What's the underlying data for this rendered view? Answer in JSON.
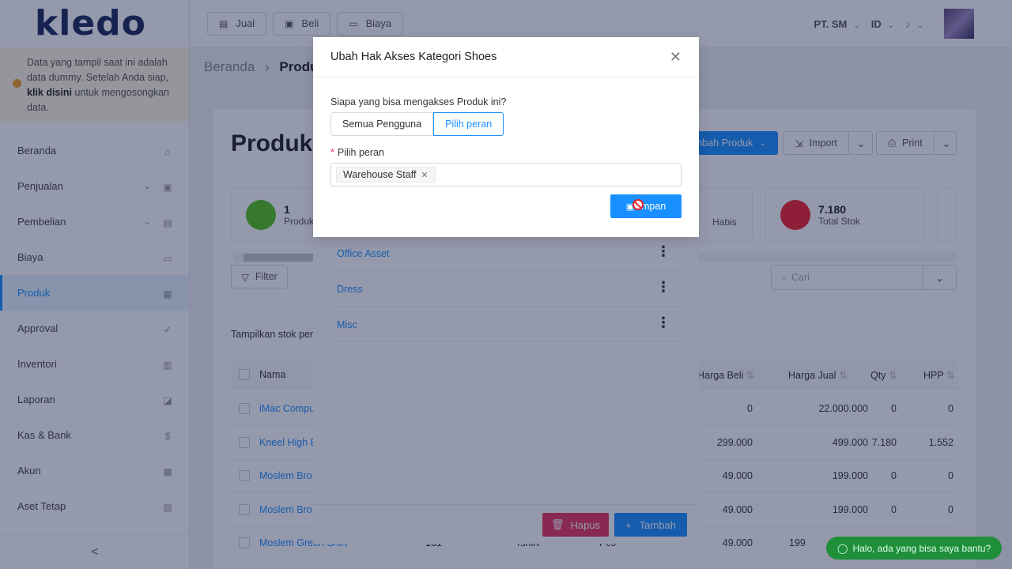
{
  "logo": "kledo",
  "notice": {
    "text_before": "Data yang tampil saat ini adalah data dummy. Setelah Anda siap, ",
    "link": "klik disini",
    "text_after": " untuk mengosongkan data."
  },
  "sidebar": {
    "items": [
      {
        "label": "Beranda",
        "icon": "home-icon"
      },
      {
        "label": "Penjualan",
        "icon": "basket-icon",
        "expand": true
      },
      {
        "label": "Pembelian",
        "icon": "bag-icon",
        "expand": true
      },
      {
        "label": "Biaya",
        "icon": "card-icon"
      },
      {
        "label": "Produk",
        "icon": "box-icon",
        "active": true
      },
      {
        "label": "Approval",
        "icon": "check-icon"
      },
      {
        "label": "Inventori",
        "icon": "warehouse-icon"
      },
      {
        "label": "Laporan",
        "icon": "chart-icon"
      },
      {
        "label": "Kas & Bank",
        "icon": "dollar-icon"
      },
      {
        "label": "Akun",
        "icon": "ledger-icon"
      },
      {
        "label": "Aset Tetap",
        "icon": "building-icon"
      }
    ],
    "collapse": "<"
  },
  "header": {
    "buttons": {
      "jual": "Jual",
      "beli": "Beli",
      "biaya": "Biaya"
    },
    "company": "PT. SM",
    "language": "ID"
  },
  "breadcrumb": {
    "home": "Beranda",
    "sep": "›",
    "current": "Produk"
  },
  "page": {
    "title": "Produk",
    "add_button": "nbah Produk",
    "import_button": "Import",
    "print_button": "Print"
  },
  "stats": [
    {
      "num": "1",
      "label": "Produk",
      "color": "#52c41a"
    },
    {
      "num": "",
      "label": "Habis",
      "color": ""
    },
    {
      "num": "7.180",
      "label": "Total Stok",
      "color": "#f5222d"
    }
  ],
  "toolbar": {
    "filter": "Filter",
    "search_placeholder": "Cari"
  },
  "stock_label": "Tampilkan stok per",
  "table": {
    "headers": {
      "nama": "Nama",
      "harga_beli": "Harga Beli",
      "harga_jual": "Harga Jual",
      "qty": "Qty",
      "hpp": "HPP"
    },
    "rows": [
      {
        "nama": "iMac Compu",
        "harga_beli": "0",
        "harga_jual": "22.000.000",
        "qty": "0",
        "hpp": "0"
      },
      {
        "nama": "Kneel High B",
        "harga_beli": "299.000",
        "harga_jual": "499.000",
        "qty": "7.180",
        "hpp": "1.552"
      },
      {
        "nama": "Moslem Bro",
        "harga_beli": "49.000",
        "harga_jual": "199.000",
        "qty": "0",
        "hpp": "0"
      },
      {
        "nama": "Moslem Bro",
        "harga_beli": "49.000",
        "harga_jual": "199.000",
        "qty": "0",
        "hpp": "0"
      },
      {
        "nama": "Moslem Green Shirt",
        "code": "131",
        "cat": "Tshirt",
        "unit": "Pcs",
        "harga_beli": "49.000",
        "harga_jual": "199"
      }
    ]
  },
  "drawer": {
    "categories": [
      "Office Asset",
      "Dress",
      "Misc"
    ],
    "delete_button": "Hapus",
    "add_button": "Tambah"
  },
  "modal": {
    "title": "Ubah Hak Akses Kategori Shoes",
    "question": "Siapa yang bisa mengakses Produk ini?",
    "options": [
      "Semua Pengguna",
      "Pilih peran"
    ],
    "selected_option": "Pilih peran",
    "field_label": "Pilih peran",
    "selected_roles": [
      "Warehouse Staff"
    ],
    "save_button": "impan"
  },
  "chat": {
    "text": "Halo, ada yang bisa saya bantu?"
  }
}
